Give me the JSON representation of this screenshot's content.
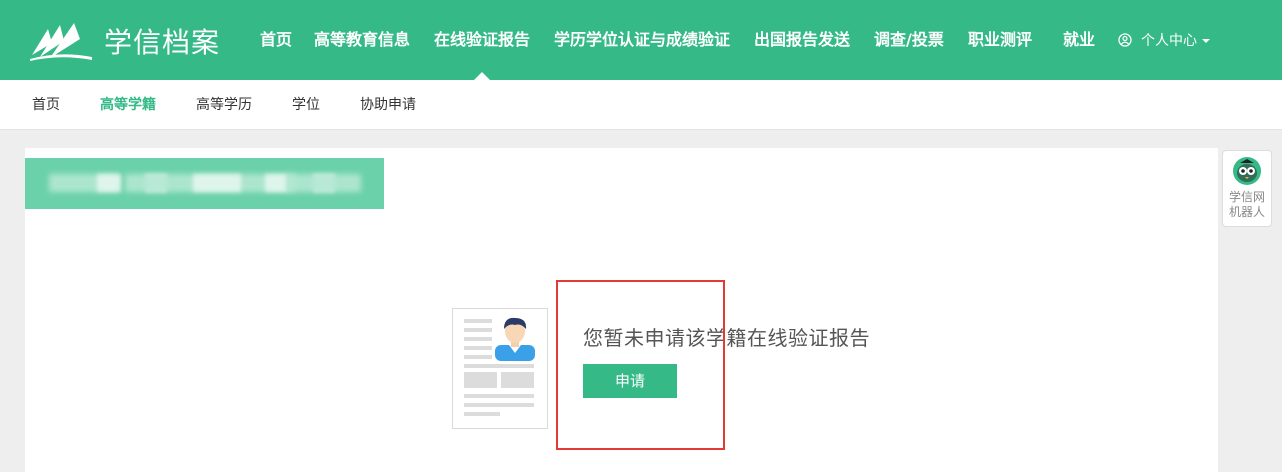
{
  "header": {
    "logo_text": "学信档案",
    "nav": [
      {
        "label": "首页"
      },
      {
        "label": "高等教育信息"
      },
      {
        "label": "在线验证报告"
      },
      {
        "label": "学历学位认证与成绩验证"
      },
      {
        "label": "出国报告发送"
      },
      {
        "label": "调查/投票"
      },
      {
        "label": "职业测评"
      },
      {
        "label": "就业"
      }
    ],
    "active_nav": "在线验证报告",
    "user_menu": "个人中心"
  },
  "subnav": {
    "items": [
      {
        "label": "首页"
      },
      {
        "label": "高等学籍"
      },
      {
        "label": "高等学历"
      },
      {
        "label": "学位"
      },
      {
        "label": "协助申请"
      }
    ],
    "active": "高等学籍"
  },
  "main": {
    "banner_text": "",
    "empty_message": "您暂未申请该学籍在线验证报告",
    "apply_button": "申请"
  },
  "robot": {
    "line1": "学信网",
    "line2": "机器人"
  },
  "colors": {
    "brand": "#34b987",
    "banner": "#6bd1aa",
    "highlight": "#e53935"
  },
  "icons": [
    "logo-icon",
    "user-icon",
    "chevron-down-icon",
    "resume-illustration",
    "robot-icon"
  ]
}
